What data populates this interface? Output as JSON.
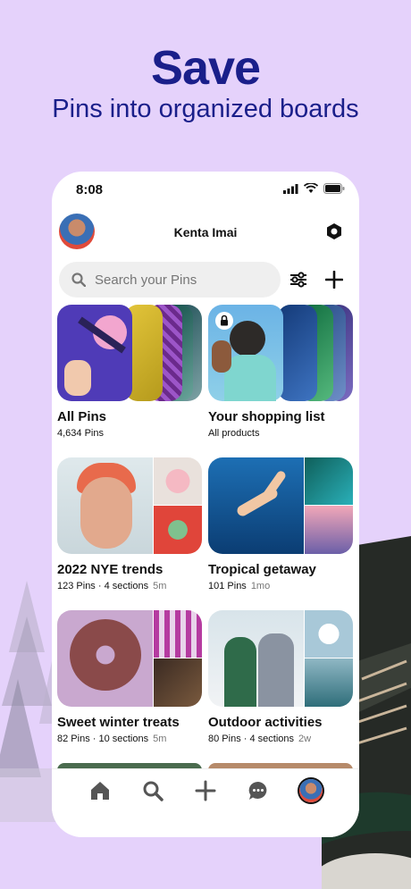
{
  "promo": {
    "headline": "Save",
    "subheadline": "Pins into organized boards"
  },
  "status_bar": {
    "time": "8:08"
  },
  "profile": {
    "name": "Kenta Imai"
  },
  "search": {
    "placeholder": "Search your Pins"
  },
  "boards": [
    {
      "title": "All Pins",
      "meta": "4,634 Pins",
      "age": ""
    },
    {
      "title": "Your shopping list",
      "meta": "All products",
      "age": ""
    },
    {
      "title": "2022 NYE trends",
      "meta": "123 Pins · 4 sections",
      "age": "5m"
    },
    {
      "title": "Tropical getaway",
      "meta": "101 Pins",
      "age": "1mo"
    },
    {
      "title": "Sweet winter treats",
      "meta": "82 Pins · 10 sections",
      "age": "5m"
    },
    {
      "title": "Outdoor activities",
      "meta": "80 Pins · 4 sections",
      "age": "2w"
    }
  ],
  "icons": {
    "settings": "hexagon-gear-icon",
    "filter": "sliders-icon",
    "add": "plus-icon",
    "lock": "lock-icon",
    "nav": [
      "home-icon",
      "search-icon",
      "create-icon",
      "messages-icon",
      "profile-icon"
    ]
  },
  "colors": {
    "background": "#e5d2fb",
    "headline": "#1a1f8a",
    "search_bg": "#efefef"
  }
}
